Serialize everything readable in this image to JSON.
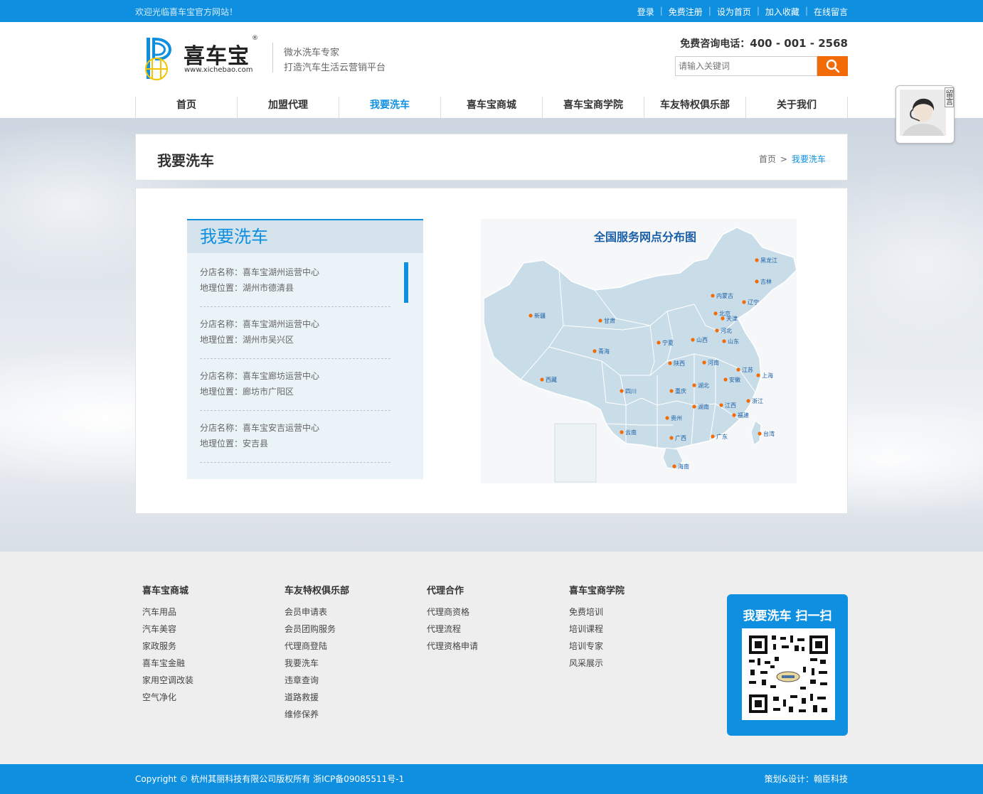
{
  "topbar": {
    "welcome": "欢迎光临喜车宝官方网站！",
    "links": [
      "登录",
      "免费注册",
      "设为首页",
      "加入收藏",
      "在线留言"
    ]
  },
  "header": {
    "logo_text": "喜车宝",
    "logo_reg": "®",
    "logo_url": "www.xichebao.com",
    "slogan_line1": "微水洗车专家",
    "slogan_line2": "打造汽车生活云营销平台",
    "hotline_label": "免费咨询电话：",
    "hotline_number": "400 - 001 - 2568",
    "search_placeholder": "请输入关键词"
  },
  "nav": {
    "items": [
      "首页",
      "加盟代理",
      "我要洗车",
      "喜车宝商城",
      "喜车宝商学院",
      "车友特权俱乐部",
      "关于我们"
    ],
    "active_index": 2
  },
  "chat_widget": {
    "label": "留言"
  },
  "page": {
    "title": "我要洗车",
    "breadcrumb": {
      "home": "首页",
      "separator": ">",
      "current": "我要洗车"
    }
  },
  "store_list": {
    "heading": "我要洗车",
    "stores": [
      {
        "name": "分店名称：喜车宝湖州运营中心",
        "location": "地理位置：湖州市德清县"
      },
      {
        "name": "分店名称：喜车宝湖州运营中心",
        "location": "地理位置：湖州市吴兴区"
      },
      {
        "name": "分店名称：喜车宝廊坊运营中心",
        "location": "地理位置：廊坊市广阳区"
      },
      {
        "name": "分店名称：喜车宝安吉运营中心",
        "location": "地理位置：安吉县"
      }
    ]
  },
  "map": {
    "title": "全国服务网点分布图",
    "provinces": [
      "黑龙江",
      "吉林",
      "辽宁",
      "内蒙古",
      "北京",
      "天津",
      "河北",
      "新疆",
      "甘肃",
      "宁夏",
      "山西",
      "山东",
      "青海",
      "陕西",
      "河南",
      "江苏",
      "上海",
      "安徽",
      "西藏",
      "四川",
      "重庆",
      "湖北",
      "浙江",
      "湖南",
      "江西",
      "贵州",
      "福建",
      "云南",
      "广西",
      "广东",
      "台湾",
      "海南"
    ]
  },
  "footer": {
    "columns": [
      {
        "title": "喜车宝商城",
        "links": [
          "汽车用品",
          "汽车美容",
          "家政服务",
          "喜车宝金融",
          "家用空调改装",
          "空气净化"
        ]
      },
      {
        "title": "车友特权俱乐部",
        "links": [
          "会员申请表",
          "会员团购服务",
          "代理商登陆",
          "我要洗车",
          "违章查询",
          "道路救援",
          "维修保养"
        ]
      },
      {
        "title": "代理合作",
        "links": [
          "代理商资格",
          "代理流程",
          "代理资格申请"
        ]
      },
      {
        "title": "喜车宝商学院",
        "links": [
          "免费培训",
          "培训课程",
          "培训专家",
          "风采展示"
        ]
      }
    ],
    "qr_title": "我要洗车 扫一扫"
  },
  "bottom": {
    "copyright": "Copyright © 杭州其丽科技有限公司版权所有 浙ICP备09085511号-1",
    "design": "策划&设计：翰臣科技"
  },
  "colors": {
    "brand_blue": "#0e8fe0",
    "search_orange": "#f26b06",
    "map_title": "#1a5fa7",
    "city_dot": "#f26b06"
  },
  "icons": [
    "search-icon",
    "logo-p-icon",
    "customer-service-portrait",
    "qr-code"
  ]
}
